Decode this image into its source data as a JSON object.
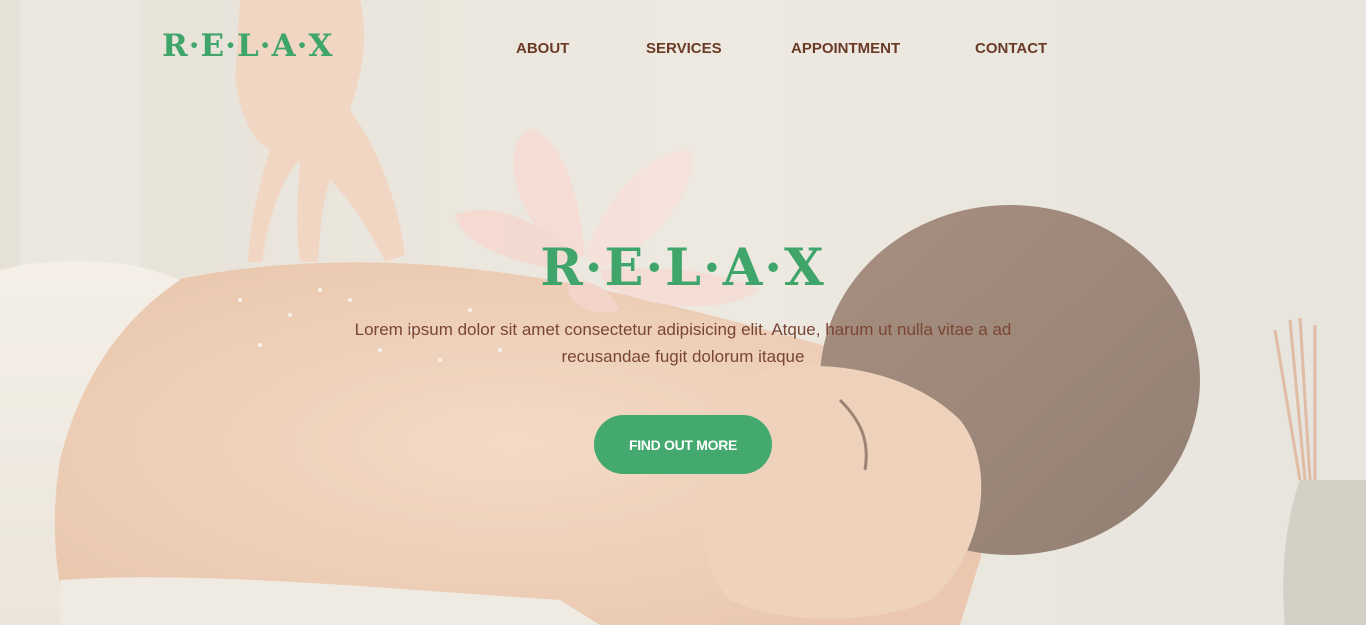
{
  "brand": {
    "logo": "R·E·L·A·X"
  },
  "nav": {
    "items": [
      {
        "label": "ABOUT"
      },
      {
        "label": "SERVICES"
      },
      {
        "label": "APPOINTMENT"
      },
      {
        "label": "CONTACT"
      }
    ]
  },
  "hero": {
    "title": "R·E·L·A·X",
    "text": "Lorem ipsum dolor sit amet consectetur adipisicing elit. Atque, harum ut nulla vitae a ad recusandae fugit dolorum itaque",
    "cta_label": "FIND OUT MORE",
    "image_icon": "massage-photo"
  },
  "colors": {
    "brand_green": "#3fa56b",
    "nav_brown": "#6b3a24",
    "text_brown": "#7a4533",
    "button_green": "#43a96e"
  }
}
